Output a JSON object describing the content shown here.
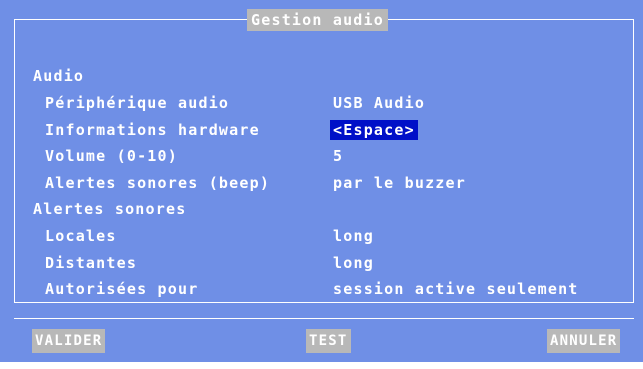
{
  "window": {
    "title": "Gestion audio"
  },
  "sections": {
    "audio": {
      "heading": "Audio",
      "rows": [
        {
          "label": "Périphérique audio",
          "value": "USB Audio"
        },
        {
          "label": "Informations hardware",
          "value": "<Espace>"
        },
        {
          "label": "Volume (0-10)",
          "value": "5"
        },
        {
          "label": "Alertes sonores (beep)",
          "value": "par le buzzer"
        }
      ]
    },
    "alerts": {
      "heading": "Alertes sonores",
      "rows": [
        {
          "label": "Locales",
          "value": "long"
        },
        {
          "label": "Distantes",
          "value": "long"
        },
        {
          "label": "Autorisées pour",
          "value": "session active seulement"
        }
      ]
    }
  },
  "buttons": {
    "validate": "VALIDER",
    "test": "TEST",
    "cancel": "ANNULER"
  },
  "colors": {
    "background": "#6f8fe6",
    "highlight": "#0010c8",
    "button_bg": "#b8b8b8",
    "text": "#ffffff"
  }
}
